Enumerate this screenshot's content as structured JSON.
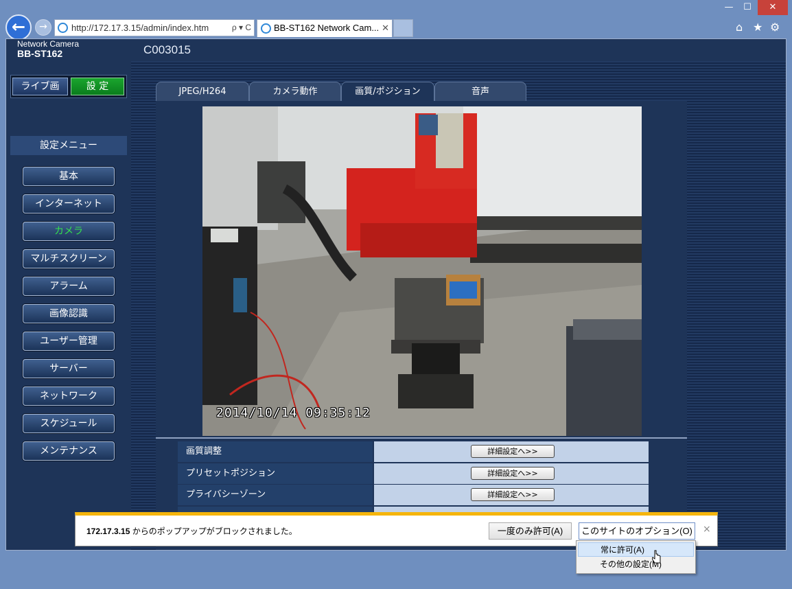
{
  "browser": {
    "window_controls": {
      "minimize": "—",
      "maximize": "☐",
      "close": "✕"
    },
    "address_url": "http://172.17.3.15/admin/index.htm",
    "address_tools": "ρ ▾ C",
    "tab_title": "BB-ST162 Network Cam...",
    "tab_close": "✕"
  },
  "header": {
    "product_line": "Network Camera",
    "model": "BB-ST162",
    "camera_name": "C003015"
  },
  "top_buttons": {
    "live": "ライブ画",
    "setup": "設 定"
  },
  "sidebar": {
    "menu_title": "設定メニュー",
    "items": [
      {
        "label": "基本"
      },
      {
        "label": "インターネット"
      },
      {
        "label": "カメラ",
        "active": true
      },
      {
        "label": "マルチスクリーン"
      },
      {
        "label": "アラーム"
      },
      {
        "label": "画像認識"
      },
      {
        "label": "ユーザー管理"
      },
      {
        "label": "サーバー"
      },
      {
        "label": "ネットワーク"
      },
      {
        "label": "スケジュール"
      },
      {
        "label": "メンテナンス"
      }
    ]
  },
  "tabs": [
    {
      "label": "JPEG/H264"
    },
    {
      "label": "カメラ動作"
    },
    {
      "label": "画質/ポジション",
      "active": true
    },
    {
      "label": "音声"
    }
  ],
  "video": {
    "timestamp": "2014/10/14  09:35:12"
  },
  "settings_rows": [
    {
      "label": "画質調整",
      "button": "詳細設定へ>>"
    },
    {
      "label": "プリセットポジション",
      "button": "詳細設定へ>>"
    },
    {
      "label": "プライバシーゾーン",
      "button": "詳細設定へ>>"
    }
  ],
  "popup": {
    "ip": "172.17.3.15",
    "message": " からのポップアップがブロックされました。",
    "allow_once": "一度のみ許可(A)",
    "site_options": "このサイトのオプション(O) ▾",
    "close": "×",
    "dropdown": [
      {
        "label": "常に許可(A)",
        "highlighted": true
      },
      {
        "label": "その他の設定(M)"
      }
    ]
  },
  "colors": {
    "page_bg": "#1e3458",
    "setup_green": "#0a7d1d",
    "active_menu_text": "#34e04e",
    "popup_border": "#f5b50c"
  }
}
